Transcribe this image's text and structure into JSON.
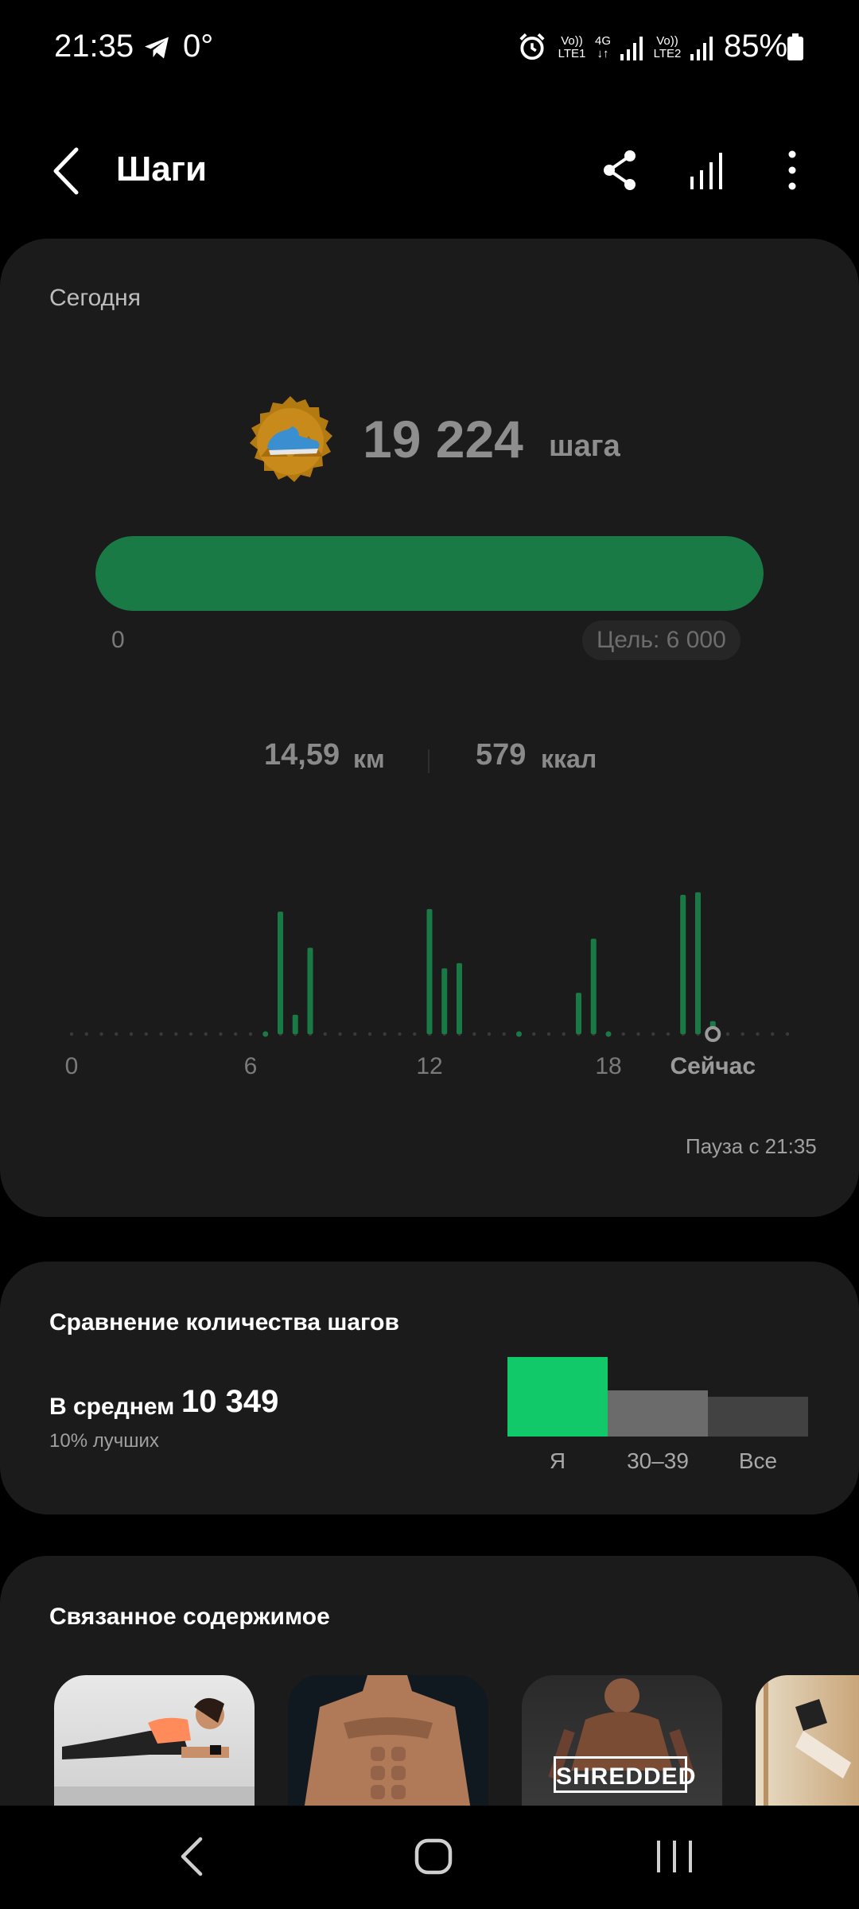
{
  "status_bar": {
    "time": "21:35",
    "temperature": "0°",
    "sim1_line1": "Vo))",
    "sim1_line2": "LTE1",
    "net_line1": "4G",
    "net_line2": "↓↑",
    "sim2_line1": "Vo))",
    "sim2_line2": "LTE2",
    "battery": "85%"
  },
  "header": {
    "title": "Шаги"
  },
  "today_card": {
    "label": "Сегодня",
    "steps_value": "19 224",
    "steps_unit": "шага",
    "progress_fraction": 1.0,
    "progress_min": "0",
    "goal": "Цель: 6 000",
    "distance_value": "14,59",
    "distance_unit": "км",
    "calories_value": "579",
    "calories_unit": "ккал",
    "pause_text": "Пауза с 21:35"
  },
  "chart_data": {
    "type": "bar",
    "x_ticks": [
      "0",
      "6",
      "12",
      "18",
      "Сейчас"
    ],
    "bars": [
      {
        "x": 6.5,
        "y": 0.04
      },
      {
        "x": 7.0,
        "y": 0.95
      },
      {
        "x": 7.5,
        "y": 0.15
      },
      {
        "x": 8.0,
        "y": 0.67
      },
      {
        "x": 12.0,
        "y": 0.97
      },
      {
        "x": 12.5,
        "y": 0.51
      },
      {
        "x": 13.0,
        "y": 0.55
      },
      {
        "x": 15.0,
        "y": 0.04
      },
      {
        "x": 17.0,
        "y": 0.32
      },
      {
        "x": 17.5,
        "y": 0.74
      },
      {
        "x": 18.0,
        "y": 0.04
      },
      {
        "x": 20.5,
        "y": 1.08
      },
      {
        "x": 21.0,
        "y": 1.1
      },
      {
        "x": 21.5,
        "y": 0.1
      }
    ],
    "xlim": [
      0,
      24
    ],
    "current_x": 21.5,
    "colors": {
      "bar": "#1a7a45",
      "dot": "#3a3a3a",
      "tick": "#7a7a7a",
      "now": "#9a9a9a"
    }
  },
  "compare_card": {
    "title": "Сравнение количества шагов",
    "avg_label": "В среднем",
    "avg_value": "10 349",
    "better_text": "10% лучших",
    "chart": {
      "categories": [
        "Я",
        "30–39",
        "Все"
      ],
      "values": [
        1.0,
        0.58,
        0.5
      ],
      "colors": [
        "#12c96a",
        "#6b6b6b",
        "#424242"
      ]
    }
  },
  "related_card": {
    "title": "Связанное содержимое",
    "items": [
      {
        "badge": ""
      },
      {
        "badge": ""
      },
      {
        "badge": "SHREDDED"
      },
      {
        "badge": ""
      }
    ]
  },
  "colors": {
    "background": "#000000",
    "card": "#1b1b1b",
    "accent": "#1a7a45",
    "accent_bright": "#12c96a"
  }
}
